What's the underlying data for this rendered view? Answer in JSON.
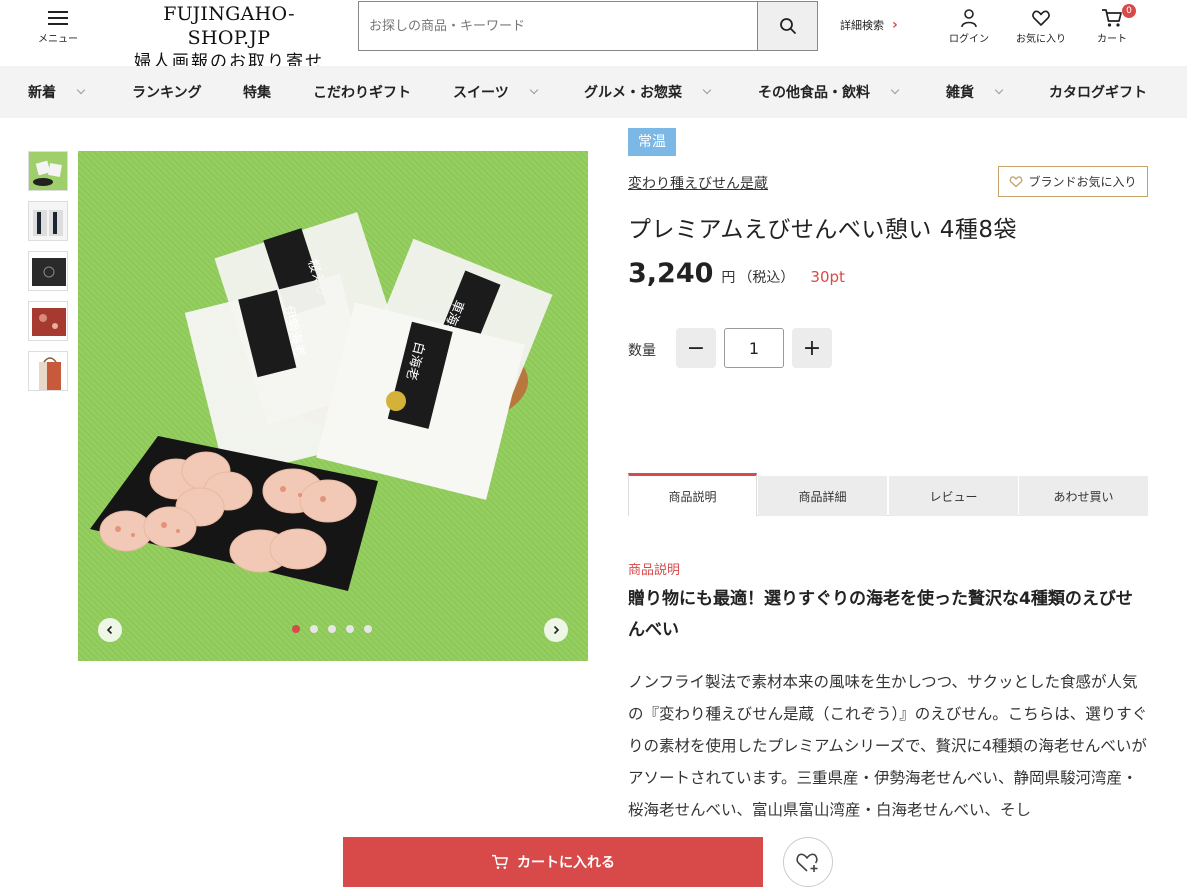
{
  "header": {
    "menu_label": "メニュー",
    "logo_en": "FUJINGAHO-SHOP.JP",
    "logo_jp": "婦人画報のお取り寄せ",
    "search_placeholder": "お探しの商品・キーワード",
    "advanced_search": "詳細検索",
    "login": "ログイン",
    "favorites": "お気に入り",
    "cart": "カート",
    "cart_count": "0"
  },
  "nav": {
    "items": [
      {
        "label": "新着"
      },
      {
        "label": "ランキング"
      },
      {
        "label": "特集"
      },
      {
        "label": "こだわりギフト"
      },
      {
        "label": "スイーツ"
      },
      {
        "label": "グルメ・お惣菜"
      },
      {
        "label": "その他食品・飲料"
      },
      {
        "label": "雑貨"
      },
      {
        "label": "カタログギフト"
      }
    ]
  },
  "gallery": {
    "thumbnail_count": 5,
    "active_index": 0,
    "package_labels": [
      "桜えび",
      "伊勢海老",
      "車海老",
      "白海老"
    ]
  },
  "product": {
    "storage_tag": "常温",
    "brand": "変わり種えびせん是蔵",
    "brand_fav_label": "ブランドお気に入り",
    "title": "プレミアムえびせんべい憩い 4種8袋",
    "price": "3,240",
    "price_unit": "円",
    "tax_label": "（税込）",
    "points": "30pt",
    "qty_label": "数量",
    "qty_value": "1",
    "qty_minus": "−",
    "qty_plus": "+"
  },
  "tabs": [
    {
      "label": "商品説明"
    },
    {
      "label": "商品詳細"
    },
    {
      "label": "レビュー"
    },
    {
      "label": "あわせ買い"
    }
  ],
  "description": {
    "section_label": "商品説明",
    "headline": "贈り物にも最適！選りすぐりの海老を使った贅沢な4種類のえびせんべい",
    "body": "ノンフライ製法で素材本来の風味を生かしつつ、サクッとした食感が人気の『変わり種えびせん是蔵（これぞう）』のえびせん。こちらは、選りすぐりの素材を使用したプレミアムシリーズで、贅沢に4種類の海老せんべいがアソートされています。三重県産・伊勢海老せんべい、静岡県駿河湾産・桜海老せんべい、富山県富山湾産・白海老せんべい、そし"
  },
  "bottom_bar": {
    "add_to_cart": "カートに入れる"
  },
  "colors": {
    "accent": "#d84a4a",
    "tag_blue": "#7bb8e6",
    "nav_bg": "#f3f3f3",
    "brand_border": "#c7a36b"
  }
}
